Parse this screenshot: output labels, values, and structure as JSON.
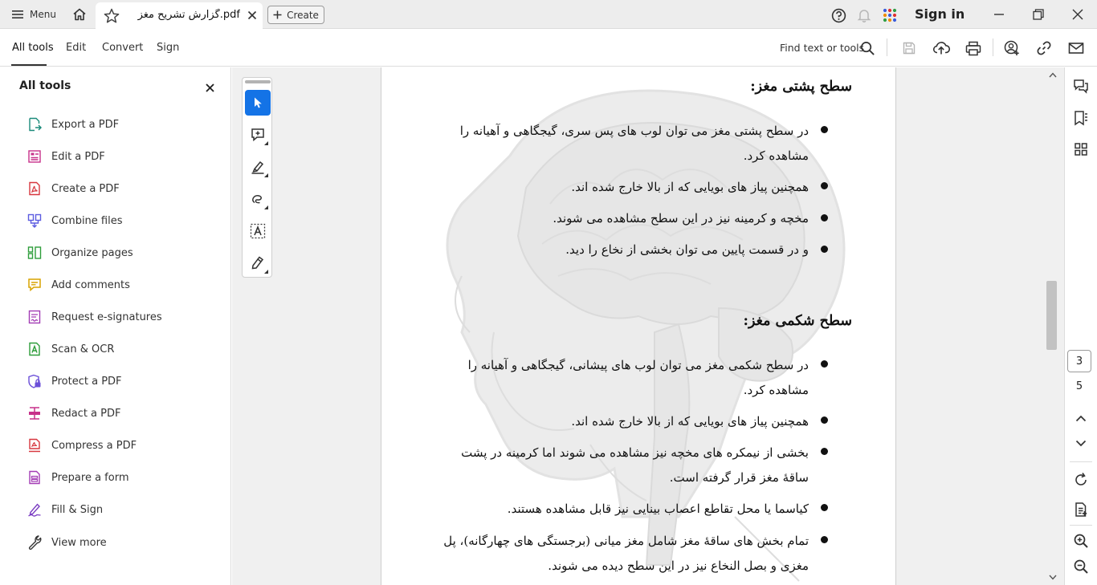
{
  "titlebar": {
    "menu_label": "Menu",
    "tab_title": "گزارش تشریح مغز.pdf",
    "create_label": "Create",
    "sign_in": "Sign in"
  },
  "toolbar": {
    "tabs": [
      "All tools",
      "Edit",
      "Convert",
      "Sign"
    ],
    "find_label": "Find text or tools"
  },
  "left_panel": {
    "title": "All tools",
    "items": [
      {
        "label": "Export a PDF",
        "icon": "export-pdf-icon",
        "color": "#1a8a7a"
      },
      {
        "label": "Edit a PDF",
        "icon": "edit-pdf-icon",
        "color": "#c7308a"
      },
      {
        "label": "Create a PDF",
        "icon": "create-pdf-icon",
        "color": "#d7373f"
      },
      {
        "label": "Combine files",
        "icon": "combine-files-icon",
        "color": "#5c5ce0"
      },
      {
        "label": "Organize pages",
        "icon": "organize-pages-icon",
        "color": "#2d9d3a"
      },
      {
        "label": "Add comments",
        "icon": "add-comments-icon",
        "color": "#d9a400"
      },
      {
        "label": "Request e-signatures",
        "icon": "request-esign-icon",
        "color": "#a33cb5"
      },
      {
        "label": "Scan & OCR",
        "icon": "scan-ocr-icon",
        "color": "#2d9d3a"
      },
      {
        "label": "Protect a PDF",
        "icon": "protect-pdf-icon",
        "color": "#6b4fd8"
      },
      {
        "label": "Redact a PDF",
        "icon": "redact-pdf-icon",
        "color": "#c7308a"
      },
      {
        "label": "Compress a PDF",
        "icon": "compress-pdf-icon",
        "color": "#d7373f"
      },
      {
        "label": "Prepare a form",
        "icon": "prepare-form-icon",
        "color": "#a33cb5"
      },
      {
        "label": "Fill & Sign",
        "icon": "fill-sign-icon",
        "color": "#7a3cc2"
      }
    ],
    "view_more": "View more"
  },
  "document": {
    "section1": {
      "heading": "سطح پشتی مغز:",
      "bullets": [
        {
          "lines": [
            "در سطح پشتی مغز می توان لوب های پس سری، گیجگاهی و آهیانه را",
            "مشاهده کرد."
          ]
        },
        {
          "lines": [
            "همچنین پیاز های بویایی که از بالا خارج شده اند."
          ]
        },
        {
          "lines": [
            "مخچه و کرمینه نیز در این سطح مشاهده می شوند."
          ]
        },
        {
          "lines": [
            "و در قسمت پایین می توان بخشی از نخاع را دید."
          ]
        }
      ]
    },
    "section2": {
      "heading": "سطح شکمی مغز:",
      "bullets": [
        {
          "lines": [
            "در سطح شکمی مغز می توان لوب های پیشانی، گیجگاهی و آهیانه را",
            "مشاهده کرد."
          ]
        },
        {
          "lines": [
            "همچنین پیاز های بویایی که از بالا خارج شده اند."
          ]
        },
        {
          "lines": [
            "بخشی از نیمکره های مخچه نیز مشاهده می شوند اما کرمینه در پشت",
            "ساقهٔ مغز قرار گرفته است."
          ]
        },
        {
          "lines": [
            "کیاسما یا محل تقاطع اعصاب بینایی نیز قابل مشاهده هستند."
          ]
        },
        {
          "lines": [
            "تمام بخش های ساقهٔ مغز شامل مغز میانی (برجستگی های چهارگانه)، پل",
            "مغزی و بصل النخاع نیز در این سطح دیده می شوند."
          ]
        }
      ]
    }
  },
  "pagination": {
    "current_page": "3",
    "total_pages": "5"
  },
  "colors": {
    "accent": "#1473e6",
    "titlebar_bg": "#ededed",
    "canvas_bg": "#f0f0f0"
  }
}
